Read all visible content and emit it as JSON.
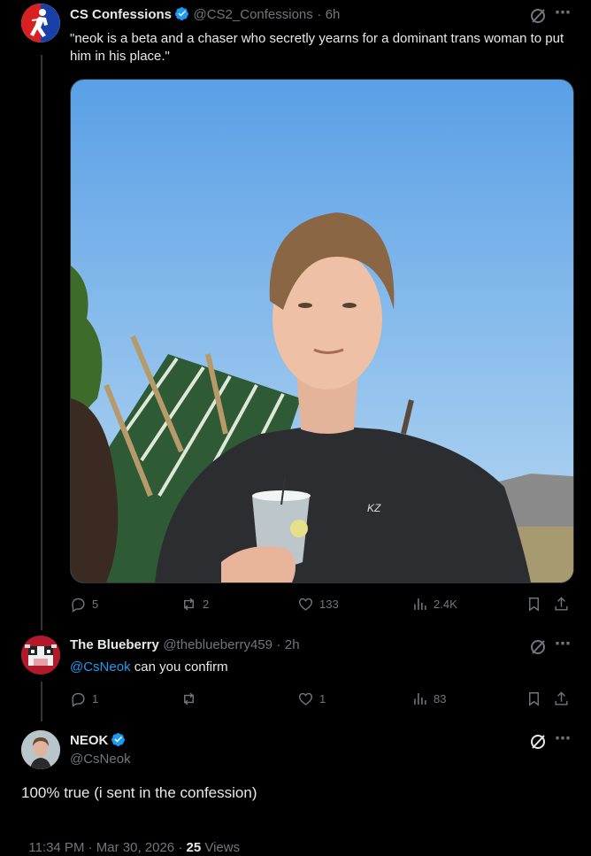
{
  "tweet1": {
    "name": "CS Confessions",
    "handle": "@CS2_Confessions",
    "time": "6h",
    "text": "\"neok is a beta and a chaser who secretly yearns for a dominant trans woman to put him in his place.\"",
    "replies": "5",
    "reposts": "2",
    "likes": "133",
    "views": "2.4K",
    "shirt_logo": "KZ"
  },
  "tweet2": {
    "name": "The Blueberry",
    "handle": "@theblueberry459",
    "time": "2h",
    "mention": "@CsNeok",
    "text": " can you confirm",
    "replies": "1",
    "reposts": "",
    "likes": "1",
    "views": "83"
  },
  "tweet3": {
    "name": "NEOK",
    "handle": "@CsNeok",
    "text": "100% true (i sent in the confession)",
    "timestamp": "11:34 PM · Mar 30, 2026 · ",
    "views_count": "25",
    "views_label": " Views"
  },
  "separator": "·",
  "more_icon": "⋯",
  "colors": {
    "accent": "#1d9bf0",
    "muted": "#71767b",
    "text": "#e7e9ea",
    "background": "#000000"
  }
}
